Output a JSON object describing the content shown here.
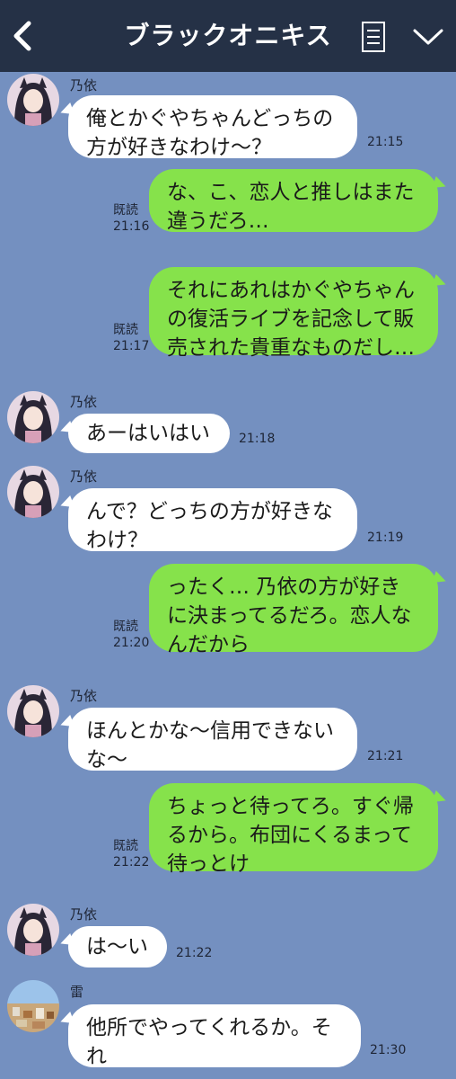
{
  "header": {
    "title": "ブラックオニキス"
  },
  "messages": [
    {
      "sender": "乃依",
      "text": "俺とかぐやちゃんどっちの\n方が好きなわけ〜？",
      "time": "21:15"
    },
    {
      "read": "既読",
      "text": "な、こ、恋人と推しはまた\n違うだろ…",
      "time": "21:16"
    },
    {
      "read": "既読",
      "text": "それにあれはかぐやちゃん\nの復活ライブを記念して販\n売された貴重なものだし…",
      "time": "21:17"
    },
    {
      "sender": "乃依",
      "text": "あーはいはい",
      "time": "21:18"
    },
    {
      "sender": "乃依",
      "text": "んで？どっちの方が好きな\nわけ？",
      "time": "21:19"
    },
    {
      "read": "既読",
      "text": "ったく… 乃依の方が好き\nに決まってるだろ。恋人な\nんだから",
      "time": "21:20"
    },
    {
      "sender": "乃依",
      "text": "ほんとかな〜信用できない\nな〜",
      "time": "21:21"
    },
    {
      "read": "既読",
      "text": "ちょっと待ってろ。すぐ帰\nるから。布団にくるまって\n待っとけ",
      "time": "21:22"
    },
    {
      "sender": "乃依",
      "text": "は〜い",
      "time": "21:22"
    },
    {
      "sender": "雷",
      "text": "他所でやってくれるか。そ\nれ",
      "time": "21:30"
    }
  ],
  "colors": {
    "background": "#7490c0",
    "header": "#253146",
    "outgoing_bubble": "#86e24b",
    "incoming_bubble": "#ffffff"
  }
}
